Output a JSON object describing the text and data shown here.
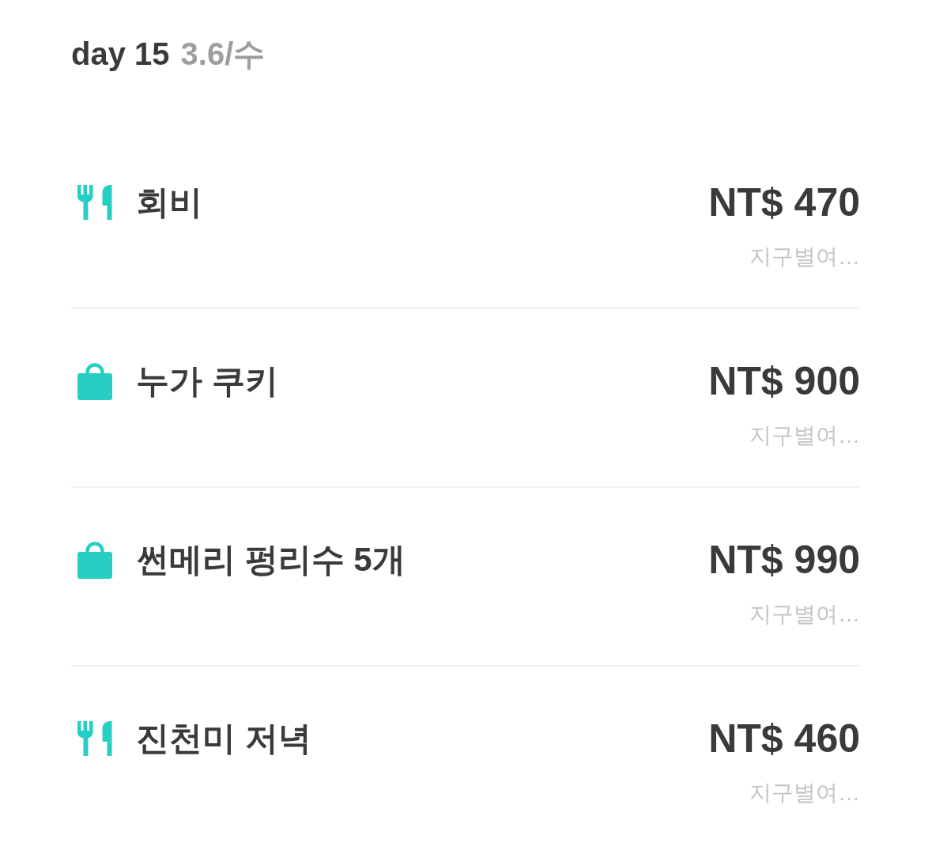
{
  "header": {
    "day": "day 15",
    "date": "3.6/수"
  },
  "items": [
    {
      "kind": "food",
      "title": "회비",
      "amount": "NT$ 470",
      "note": "지구별여…"
    },
    {
      "kind": "shopping",
      "title": "누가 쿠키",
      "amount": "NT$ 900",
      "note": "지구별여…"
    },
    {
      "kind": "shopping",
      "title": "썬메리 펑리수 5개",
      "amount": "NT$ 990",
      "note": "지구별여…"
    },
    {
      "kind": "food",
      "title": "진천미 저녁",
      "amount": "NT$ 460",
      "note": "지구별여…"
    }
  ]
}
